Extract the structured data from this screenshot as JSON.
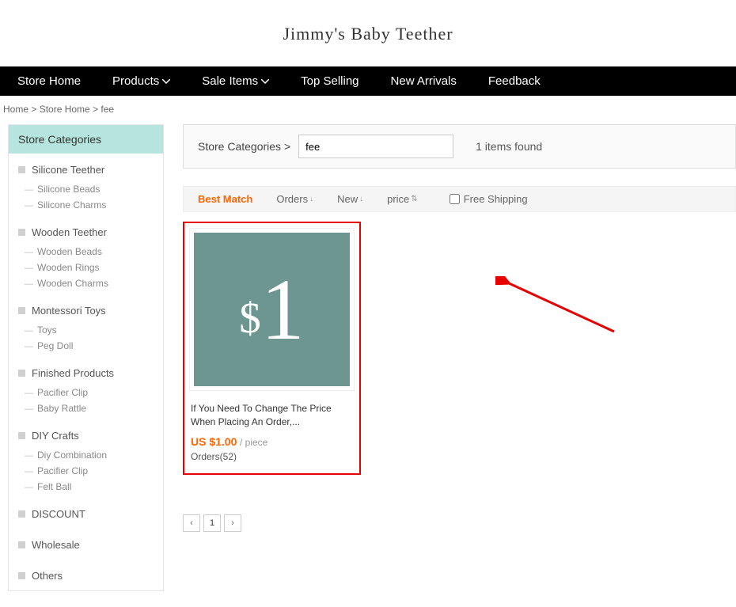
{
  "header": {
    "title": "Jimmy's  Baby  Teether"
  },
  "nav": {
    "home": "Store Home",
    "products": "Products",
    "sale": "Sale Items",
    "top": "Top Selling",
    "new": "New Arrivals",
    "feedback": "Feedback"
  },
  "breadcrumb": {
    "home": "Home",
    "store": "Store Home",
    "current": "fee"
  },
  "sidebar": {
    "title": "Store Categories",
    "groups": [
      {
        "name": "Silicone Teether",
        "subs": [
          "Silicone Beads",
          "Silicone Charms"
        ]
      },
      {
        "name": "Wooden Teether",
        "subs": [
          "Wooden Beads",
          "Wooden Rings",
          "Wooden Charms"
        ]
      },
      {
        "name": "Montessori Toys",
        "subs": [
          "Toys",
          "Peg Doll"
        ]
      },
      {
        "name": "Finished Products",
        "subs": [
          "Pacifier Clip",
          "Baby Rattle"
        ]
      },
      {
        "name": "DIY Crafts",
        "subs": [
          "Diy Combination",
          "Pacifier Clip",
          "Felt Ball"
        ]
      },
      {
        "name": "DISCOUNT",
        "subs": []
      },
      {
        "name": "Wholesale",
        "subs": []
      },
      {
        "name": "Others",
        "subs": []
      }
    ]
  },
  "search": {
    "label": "Store Categories >",
    "value": "fee",
    "results": "1 items found"
  },
  "sort": {
    "best": "Best Match",
    "orders": "Orders",
    "new": "New",
    "price": "price",
    "freeship": "Free Shipping"
  },
  "product": {
    "title": "If You Need To Change The Price When Placing An Order,...",
    "price": "US $1.00",
    "unit": "/ piece",
    "orders": "Orders(52)"
  },
  "pagination": {
    "prev": "‹",
    "page": "1",
    "next": "›"
  }
}
